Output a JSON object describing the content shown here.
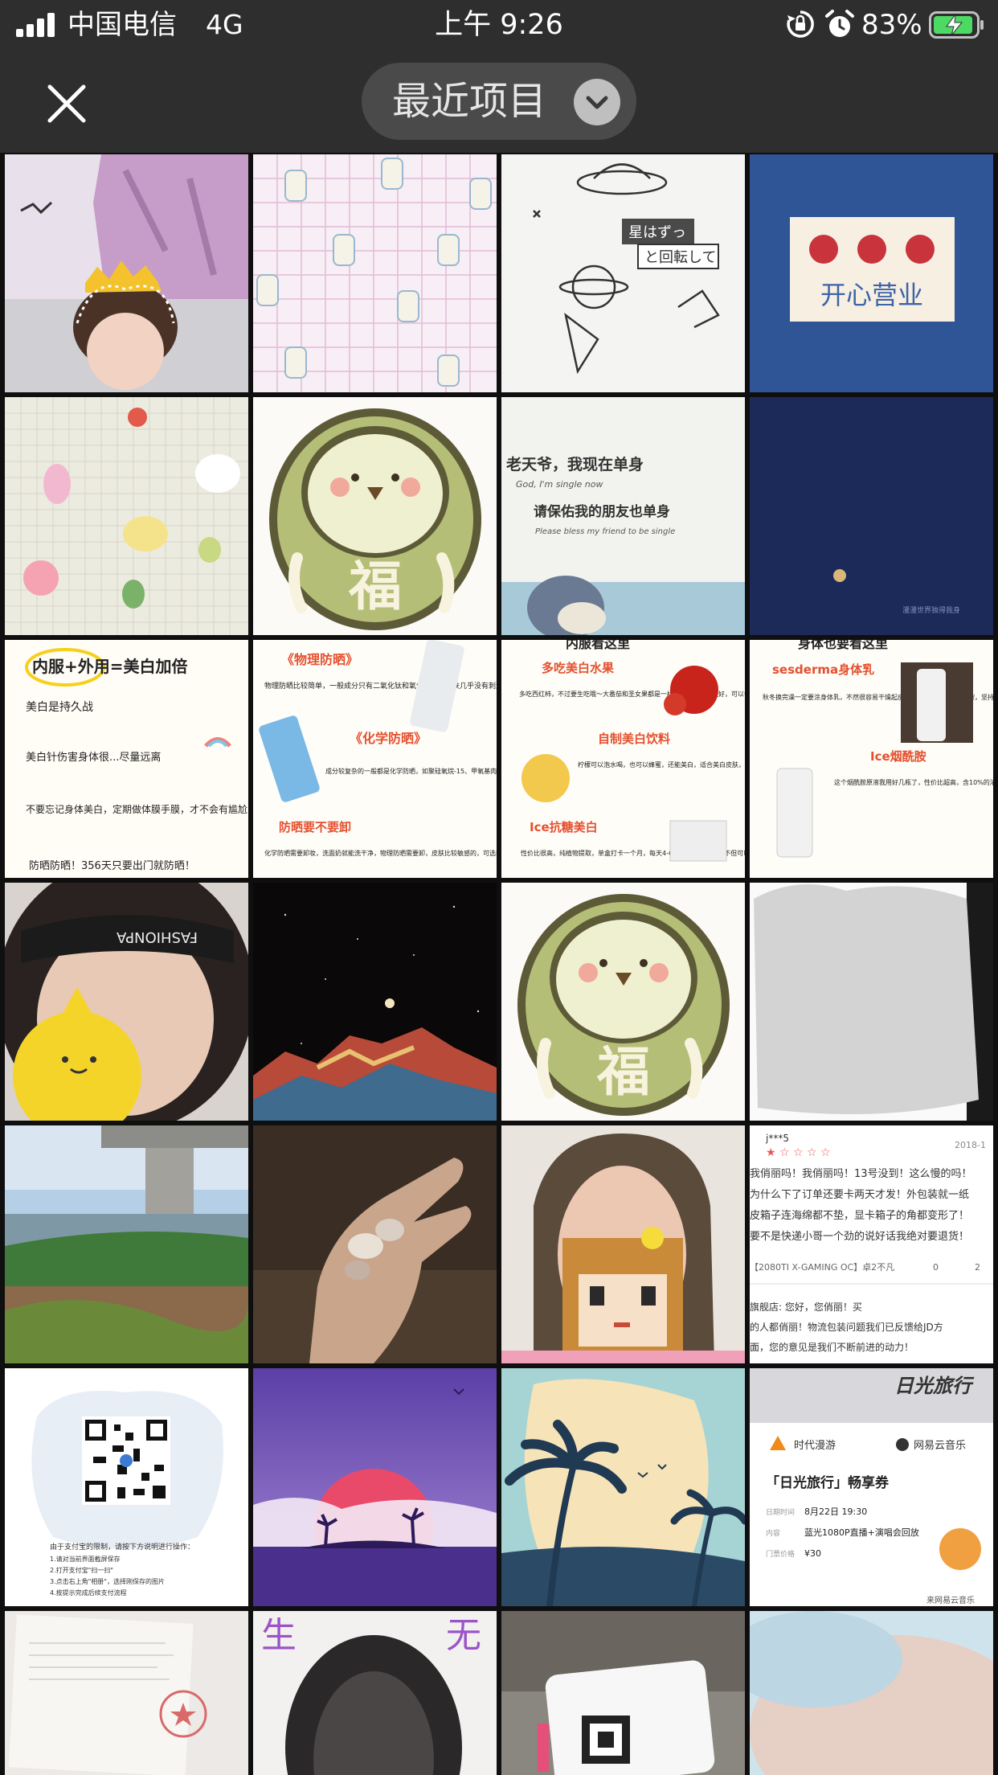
{
  "status_bar": {
    "carrier": "中国电信",
    "network": "4G",
    "time": "上午 9:26",
    "battery_percent": "83%"
  },
  "nav": {
    "album_title": "最近项目"
  },
  "colors": {
    "background": "#0f0f0f",
    "bar": "#2e2e2e",
    "pill": "#4a4a4a",
    "battery_green": "#4cd964"
  },
  "photos": {
    "p3": {
      "l1": "星はずっ",
      "l2": "と回転して"
    },
    "p4": {
      "text": "开心营业"
    },
    "p6": {
      "text": "福"
    },
    "p7": {
      "l1": "老天爷，我现在单身",
      "l2": "God, I'm single now",
      "l3": "请保佑我的朋友也单身",
      "l4": "Please bless my friend to be single"
    },
    "p8": {
      "text": "漫漫世界独得我身"
    },
    "p9": {
      "title": "内服+外用=美白加倍",
      "l1": "美白是持久战",
      "l2": "美白针伤害身体很...尽量远离",
      "l3": "不要忘记身体美白，定期做体膜手膜，才不会有尴尬的色差",
      "l4": "防晒防晒！356天只要出门就防晒！"
    },
    "p10": {
      "h1": "《物理防晒》",
      "b1": "物理防晒比较简单，一般成分只有二氧化钛和氧化锌，对皮肤几乎没有刺激，更加适合敏感皮",
      "h2": "《化学防晒》",
      "b2": "成分较复杂的一般都是化学防晒，如聚硅氧烷-15、甲氧基肉桂酸乙基己酯，倒无立体等都是化学防晒",
      "h3": "防晒要不要卸",
      "b3": "化学防晒需要卸妆，洗面奶就能洗干净，物理防晒需要卸，皮肤比较敏感的，可选择物理防晒"
    },
    "p11": {
      "top": "内服看这里",
      "h1": "多吃美白水果",
      "b1": "多吃西红柿，不过要生吃哦～大番茄和圣女果都是一样的哈～榨汁喝更好，可以每天吃",
      "h2": "自制美白饮料",
      "b2": "柠檬可以泡水喝，也可以蜂蜜，还能美白，适合美白皮肤，可以每天坚持吃一点，柠檬水搭配，才会感觉长久",
      "h3": "Ice抗糖美白",
      "b3": "性价比很高，纯植物提取，单盒打卡一个月，每天4-6颗，咀嚼或口含，不但可以"
    },
    "p12": {
      "top": "身体也要看这里",
      "h1": "sesderma身体乳",
      "b1": "秋冬换完澡一定要涂身体乳，不然很容易干燥起皮，这个身体乳含有烟酰胺，坚持使用是可以变白的！",
      "h2": "Ice烟酰胺",
      "b2": "这个烟酰胺原液我用好几瓶了，性价比超高，含10%的浓度，里面的成分很多大牌子都有，可以满足全身使用"
    },
    "p13": {
      "text": "FASHIONPA"
    },
    "p15": {
      "text": "福"
    },
    "p20": {
      "user": "j***5",
      "date": "2018-1",
      "r1": "我俏丽吗！我俏丽吗！13号没到！这么慢的吗！",
      "r2": "为什么下了订单还要卡两天才发！外包装就一纸",
      "r3": "皮箱子连海绵都不垫，显卡箱子的角都变形了！",
      "r4": "要不是快递小哥一个劲的说好话我绝对要退货！",
      "model": "【2080TI X-GAMING OC】卓2不凡",
      "likes": "0",
      "comments": "2",
      "s1": "旗舰店: 您好，您俏丽！买",
      "s2": "的人都俏丽！物流包装问题我们已反馈给JD方",
      "s3": "面，您的意见是我们不断前进的动力！"
    },
    "p21": {
      "l1": "由于支付宝的限制，请按下方说明进行操作：",
      "l2": "1.请对当前界面截屏保存",
      "l3": "2.打开支付宝\"扫一扫\"",
      "l4": "3.点击右上角\"相册\"，选择刚保存的图片",
      "l5": "4.按提示完成后续支付流程"
    },
    "p24": {
      "brand": "时代漫游",
      "app": "网易云音乐",
      "poster": "日光旅行",
      "title": "「日光旅行」畅享券",
      "date_label": "日期时间",
      "date": "8月22日 19:30",
      "content_label": "内容",
      "content": "蓝光1080P直播+演唱会回放",
      "price_label": "门票价格",
      "price": "¥30",
      "source": "来网易云音乐"
    },
    "p26": {
      "l": "生",
      "r": "无"
    }
  }
}
